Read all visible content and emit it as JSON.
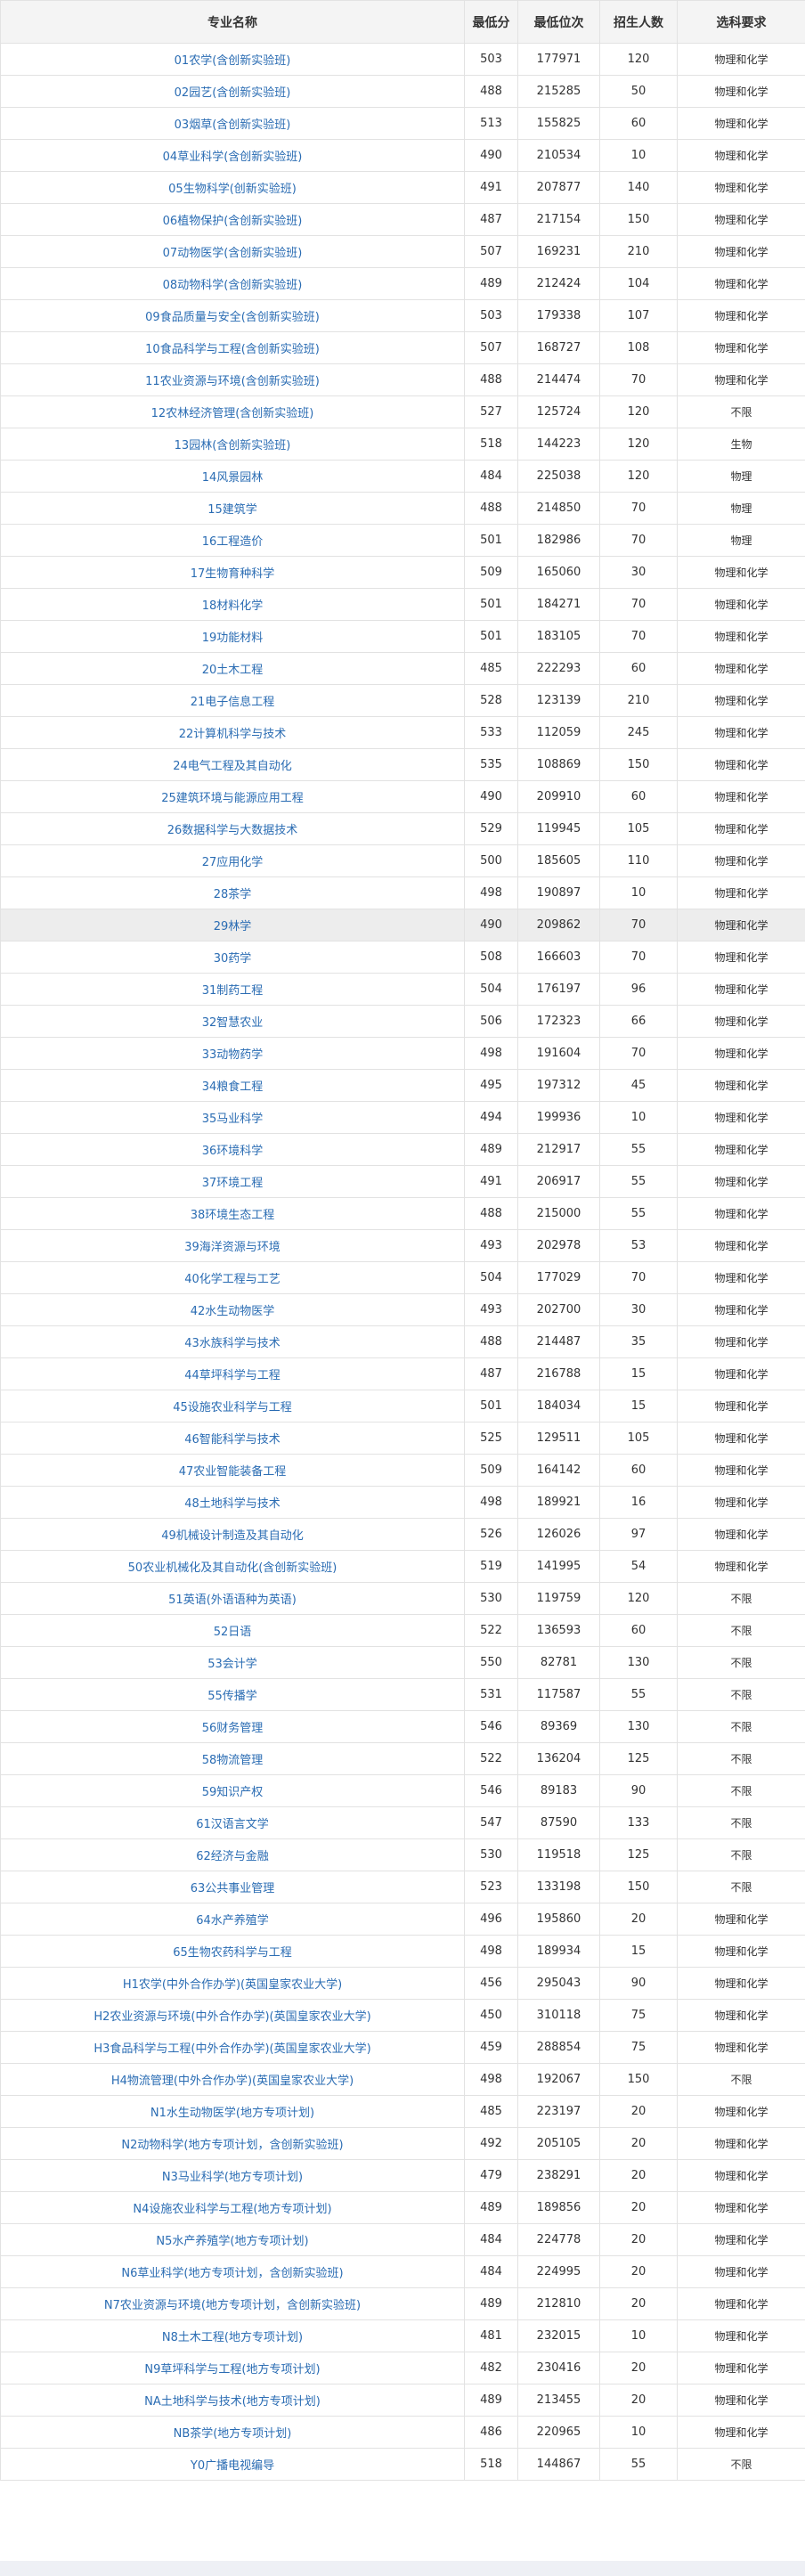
{
  "table": {
    "headers": [
      "专业名称",
      "最低分",
      "最低位次",
      "招生人数",
      "选科要求"
    ],
    "highlighted_row": 27,
    "rows": [
      [
        "01农学(含创新实验班)",
        "503",
        "177971",
        "120",
        "物理和化学"
      ],
      [
        "02园艺(含创新实验班)",
        "488",
        "215285",
        "50",
        "物理和化学"
      ],
      [
        "03烟草(含创新实验班)",
        "513",
        "155825",
        "60",
        "物理和化学"
      ],
      [
        "04草业科学(含创新实验班)",
        "490",
        "210534",
        "10",
        "物理和化学"
      ],
      [
        "05生物科学(创新实验班)",
        "491",
        "207877",
        "140",
        "物理和化学"
      ],
      [
        "06植物保护(含创新实验班)",
        "487",
        "217154",
        "150",
        "物理和化学"
      ],
      [
        "07动物医学(含创新实验班)",
        "507",
        "169231",
        "210",
        "物理和化学"
      ],
      [
        "08动物科学(含创新实验班)",
        "489",
        "212424",
        "104",
        "物理和化学"
      ],
      [
        "09食品质量与安全(含创新实验班)",
        "503",
        "179338",
        "107",
        "物理和化学"
      ],
      [
        "10食品科学与工程(含创新实验班)",
        "507",
        "168727",
        "108",
        "物理和化学"
      ],
      [
        "11农业资源与环境(含创新实验班)",
        "488",
        "214474",
        "70",
        "物理和化学"
      ],
      [
        "12农林经济管理(含创新实验班)",
        "527",
        "125724",
        "120",
        "不限"
      ],
      [
        "13园林(含创新实验班)",
        "518",
        "144223",
        "120",
        "生物"
      ],
      [
        "14风景园林",
        "484",
        "225038",
        "120",
        "物理"
      ],
      [
        "15建筑学",
        "488",
        "214850",
        "70",
        "物理"
      ],
      [
        "16工程造价",
        "501",
        "182986",
        "70",
        "物理"
      ],
      [
        "17生物育种科学",
        "509",
        "165060",
        "30",
        "物理和化学"
      ],
      [
        "18材料化学",
        "501",
        "184271",
        "70",
        "物理和化学"
      ],
      [
        "19功能材料",
        "501",
        "183105",
        "70",
        "物理和化学"
      ],
      [
        "20土木工程",
        "485",
        "222293",
        "60",
        "物理和化学"
      ],
      [
        "21电子信息工程",
        "528",
        "123139",
        "210",
        "物理和化学"
      ],
      [
        "22计算机科学与技术",
        "533",
        "112059",
        "245",
        "物理和化学"
      ],
      [
        "24电气工程及其自动化",
        "535",
        "108869",
        "150",
        "物理和化学"
      ],
      [
        "25建筑环境与能源应用工程",
        "490",
        "209910",
        "60",
        "物理和化学"
      ],
      [
        "26数据科学与大数据技术",
        "529",
        "119945",
        "105",
        "物理和化学"
      ],
      [
        "27应用化学",
        "500",
        "185605",
        "110",
        "物理和化学"
      ],
      [
        "28茶学",
        "498",
        "190897",
        "10",
        "物理和化学"
      ],
      [
        "29林学",
        "490",
        "209862",
        "70",
        "物理和化学"
      ],
      [
        "30药学",
        "508",
        "166603",
        "70",
        "物理和化学"
      ],
      [
        "31制药工程",
        "504",
        "176197",
        "96",
        "物理和化学"
      ],
      [
        "32智慧农业",
        "506",
        "172323",
        "66",
        "物理和化学"
      ],
      [
        "33动物药学",
        "498",
        "191604",
        "70",
        "物理和化学"
      ],
      [
        "34粮食工程",
        "495",
        "197312",
        "45",
        "物理和化学"
      ],
      [
        "35马业科学",
        "494",
        "199936",
        "10",
        "物理和化学"
      ],
      [
        "36环境科学",
        "489",
        "212917",
        "55",
        "物理和化学"
      ],
      [
        "37环境工程",
        "491",
        "206917",
        "55",
        "物理和化学"
      ],
      [
        "38环境生态工程",
        "488",
        "215000",
        "55",
        "物理和化学"
      ],
      [
        "39海洋资源与环境",
        "493",
        "202978",
        "53",
        "物理和化学"
      ],
      [
        "40化学工程与工艺",
        "504",
        "177029",
        "70",
        "物理和化学"
      ],
      [
        "42水生动物医学",
        "493",
        "202700",
        "30",
        "物理和化学"
      ],
      [
        "43水族科学与技术",
        "488",
        "214487",
        "35",
        "物理和化学"
      ],
      [
        "44草坪科学与工程",
        "487",
        "216788",
        "15",
        "物理和化学"
      ],
      [
        "45设施农业科学与工程",
        "501",
        "184034",
        "15",
        "物理和化学"
      ],
      [
        "46智能科学与技术",
        "525",
        "129511",
        "105",
        "物理和化学"
      ],
      [
        "47农业智能装备工程",
        "509",
        "164142",
        "60",
        "物理和化学"
      ],
      [
        "48土地科学与技术",
        "498",
        "189921",
        "16",
        "物理和化学"
      ],
      [
        "49机械设计制造及其自动化",
        "526",
        "126026",
        "97",
        "物理和化学"
      ],
      [
        "50农业机械化及其自动化(含创新实验班)",
        "519",
        "141995",
        "54",
        "物理和化学"
      ],
      [
        "51英语(外语语种为英语)",
        "530",
        "119759",
        "120",
        "不限"
      ],
      [
        "52日语",
        "522",
        "136593",
        "60",
        "不限"
      ],
      [
        "53会计学",
        "550",
        "82781",
        "130",
        "不限"
      ],
      [
        "55传播学",
        "531",
        "117587",
        "55",
        "不限"
      ],
      [
        "56财务管理",
        "546",
        "89369",
        "130",
        "不限"
      ],
      [
        "58物流管理",
        "522",
        "136204",
        "125",
        "不限"
      ],
      [
        "59知识产权",
        "546",
        "89183",
        "90",
        "不限"
      ],
      [
        "61汉语言文学",
        "547",
        "87590",
        "133",
        "不限"
      ],
      [
        "62经济与金融",
        "530",
        "119518",
        "125",
        "不限"
      ],
      [
        "63公共事业管理",
        "523",
        "133198",
        "150",
        "不限"
      ],
      [
        "64水产养殖学",
        "496",
        "195860",
        "20",
        "物理和化学"
      ],
      [
        "65生物农药科学与工程",
        "498",
        "189934",
        "15",
        "物理和化学"
      ],
      [
        "H1农学(中外合作办学)(英国皇家农业大学)",
        "456",
        "295043",
        "90",
        "物理和化学"
      ],
      [
        "H2农业资源与环境(中外合作办学)(英国皇家农业大学)",
        "450",
        "310118",
        "75",
        "物理和化学"
      ],
      [
        "H3食品科学与工程(中外合作办学)(英国皇家农业大学)",
        "459",
        "288854",
        "75",
        "物理和化学"
      ],
      [
        "H4物流管理(中外合作办学)(英国皇家农业大学)",
        "498",
        "192067",
        "150",
        "不限"
      ],
      [
        "N1水生动物医学(地方专项计划)",
        "485",
        "223197",
        "20",
        "物理和化学"
      ],
      [
        "N2动物科学(地方专项计划，含创新实验班)",
        "492",
        "205105",
        "20",
        "物理和化学"
      ],
      [
        "N3马业科学(地方专项计划)",
        "479",
        "238291",
        "20",
        "物理和化学"
      ],
      [
        "N4设施农业科学与工程(地方专项计划)",
        "489",
        "189856",
        "20",
        "物理和化学"
      ],
      [
        "N5水产养殖学(地方专项计划)",
        "484",
        "224778",
        "20",
        "物理和化学"
      ],
      [
        "N6草业科学(地方专项计划，含创新实验班)",
        "484",
        "224995",
        "20",
        "物理和化学"
      ],
      [
        "N7农业资源与环境(地方专项计划，含创新实验班)",
        "489",
        "212810",
        "20",
        "物理和化学"
      ],
      [
        "N8土木工程(地方专项计划)",
        "481",
        "232015",
        "10",
        "物理和化学"
      ],
      [
        "N9草坪科学与工程(地方专项计划)",
        "482",
        "230416",
        "20",
        "物理和化学"
      ],
      [
        "NA土地科学与技术(地方专项计划)",
        "489",
        "213455",
        "20",
        "物理和化学"
      ],
      [
        "NB茶学(地方专项计划)",
        "486",
        "220965",
        "10",
        "物理和化学"
      ],
      [
        "Y0广播电视编导",
        "518",
        "144867",
        "55",
        "不限"
      ]
    ]
  }
}
